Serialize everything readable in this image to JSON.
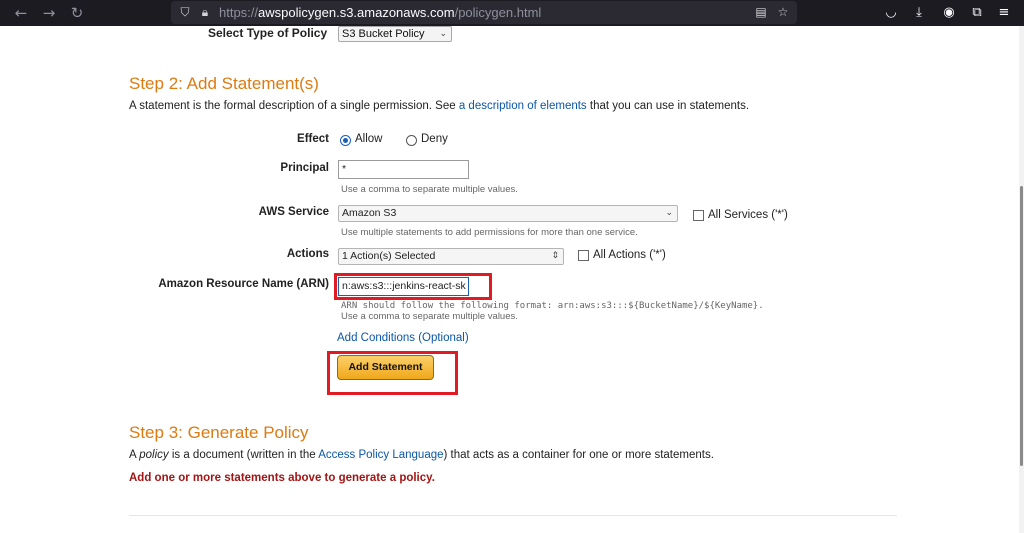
{
  "browser": {
    "url_scheme": "https://",
    "url_host": "awspolicygen.s3.amazonaws.com",
    "url_path": "/policygen.html",
    "icons": {
      "back": "arrow-left-icon",
      "forward": "arrow-right-icon",
      "reload": "reload-icon",
      "shield": "tracking-shield-icon",
      "lock": "lock-icon",
      "reader": "reader-view-icon",
      "bookmark": "star-icon",
      "pocket": "pocket-icon",
      "downloads": "download-icon",
      "account": "account-icon",
      "extensions": "extensions-icon",
      "menu": "hamburger-icon"
    }
  },
  "step1": {
    "select_type_label": "Select Type of Policy",
    "select_type_value": "S3 Bucket Policy"
  },
  "step2": {
    "heading": "Step 2: Add Statement(s)",
    "desc_before": "A statement is the formal description of a single permission. See ",
    "desc_link": "a description of elements",
    "desc_after": " that you can use in statements.",
    "effect_label": "Effect",
    "effect_allow": "Allow",
    "effect_deny": "Deny",
    "principal_label": "Principal",
    "principal_value": "*",
    "principal_hint": "Use a comma to separate multiple values.",
    "service_label": "AWS Service",
    "service_value": "Amazon S3",
    "all_services": "All Services ('*')",
    "service_hint": "Use multiple statements to add permissions for more than one service.",
    "actions_label": "Actions",
    "actions_value": "1 Action(s) Selected",
    "all_actions": "All Actions ('*')",
    "arn_label": "Amazon Resource Name (ARN)",
    "arn_value": "n:aws:s3:::jenkins-react-sk",
    "arn_hint1": "ARN should follow the following format: arn:aws:s3:::${BucketName}/${KeyName}.",
    "arn_hint2": "Use a comma to separate multiple values.",
    "add_conditions": "Add Conditions (Optional)",
    "add_statement": "Add Statement"
  },
  "step3": {
    "heading": "Step 3: Generate Policy",
    "desc_pre": "A ",
    "desc_policy": "policy",
    "desc_mid": " is a document (written in the ",
    "desc_link": "Access Policy Language",
    "desc_post": ") that acts as a container for one or more statements.",
    "error": "Add one or more statements above to generate a policy."
  },
  "colors": {
    "heading": "#dd7a10",
    "link": "#0b57a8",
    "error": "#a31515",
    "highlight": "#e01b24",
    "button": "#f0a81a"
  }
}
